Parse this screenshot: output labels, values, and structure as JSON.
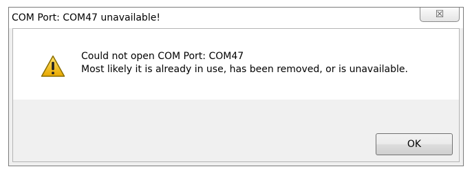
{
  "window": {
    "title": "COM Port: COM47 unavailable!",
    "close_icon": "close-icon",
    "close_glyph": "☒"
  },
  "message": {
    "icon": "warning-icon",
    "line1": "Could not open COM Port: COM47",
    "line2": "Most likely it is already in use, has been removed, or is unavailable."
  },
  "buttons": {
    "ok_label": "OK"
  },
  "colors": {
    "warning_fill": "#f5c400",
    "warning_border": "#8a6d00",
    "dialog_bg": "#f0f0f0",
    "content_bg": "#ffffff"
  }
}
